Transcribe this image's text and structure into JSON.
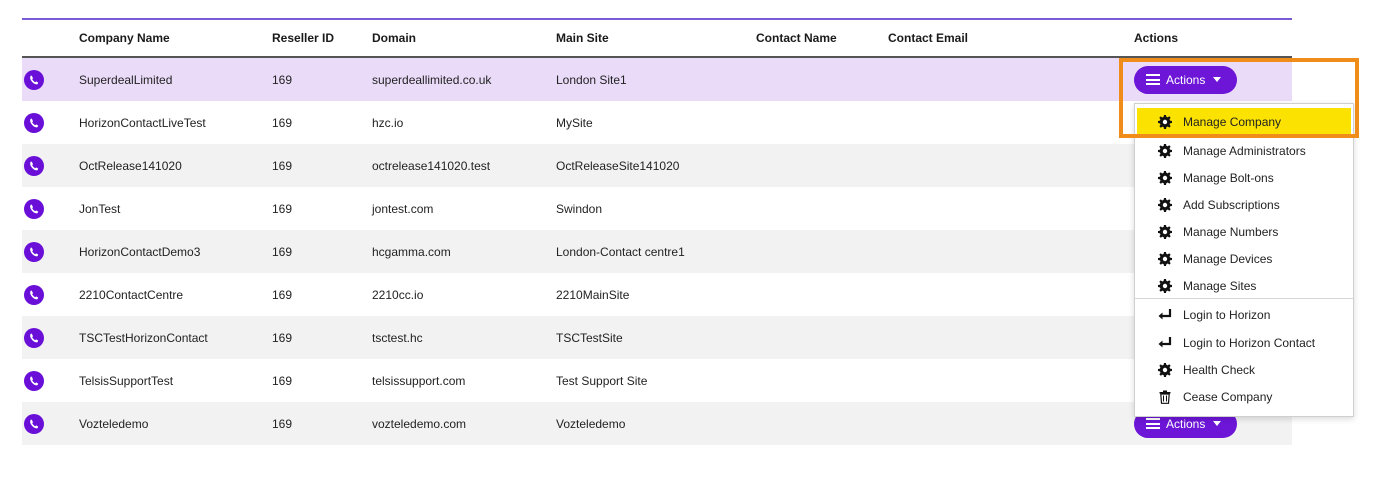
{
  "table": {
    "headers": {
      "company_name": "Company Name",
      "reseller_id": "Reseller ID",
      "domain": "Domain",
      "main_site": "Main Site",
      "contact_name": "Contact Name",
      "contact_email": "Contact Email",
      "actions": "Actions"
    },
    "rows": [
      {
        "company": "SuperdealLimited",
        "reseller": "169",
        "domain": "superdeallimited.co.uk",
        "site": "London Site1",
        "contact_name": "",
        "contact_email": ""
      },
      {
        "company": "HorizonContactLiveTest",
        "reseller": "169",
        "domain": "hzc.io",
        "site": "MySite",
        "contact_name": "",
        "contact_email": ""
      },
      {
        "company": "OctRelease141020",
        "reseller": "169",
        "domain": "octrelease141020.test",
        "site": "OctReleaseSite141020",
        "contact_name": "",
        "contact_email": ""
      },
      {
        "company": "JonTest",
        "reseller": "169",
        "domain": "jontest.com",
        "site": "Swindon",
        "contact_name": "",
        "contact_email": ""
      },
      {
        "company": "HorizonContactDemo3",
        "reseller": "169",
        "domain": "hcgamma.com",
        "site": "London-Contact centre1",
        "contact_name": "",
        "contact_email": ""
      },
      {
        "company": "2210ContactCentre",
        "reseller": "169",
        "domain": "2210cc.io",
        "site": "2210MainSite",
        "contact_name": "",
        "contact_email": ""
      },
      {
        "company": "TSCTestHorizonContact",
        "reseller": "169",
        "domain": "tsctest.hc",
        "site": "TSCTestSite",
        "contact_name": "",
        "contact_email": ""
      },
      {
        "company": "TelsisSupportTest",
        "reseller": "169",
        "domain": "telsissupport.com",
        "site": "Test Support Site",
        "contact_name": "",
        "contact_email": ""
      },
      {
        "company": "Vozteledemo",
        "reseller": "169",
        "domain": "vozteledemo.com",
        "site": "Vozteledemo",
        "contact_name": "",
        "contact_email": ""
      }
    ],
    "actions_label": "Actions"
  },
  "dropdown": {
    "items": [
      {
        "label": "Manage Company",
        "icon": "gear-icon"
      },
      {
        "label": "Manage Administrators",
        "icon": "gear-icon"
      },
      {
        "label": "Manage Bolt-ons",
        "icon": "gear-icon"
      },
      {
        "label": "Add Subscriptions",
        "icon": "gear-icon"
      },
      {
        "label": "Manage Numbers",
        "icon": "gear-icon"
      },
      {
        "label": "Manage Devices",
        "icon": "gear-icon"
      },
      {
        "label": "Manage Sites",
        "icon": "gear-icon"
      },
      {
        "label": "Login to Horizon",
        "icon": "login-arrow-icon"
      },
      {
        "label": "Login to Horizon Contact",
        "icon": "login-arrow-icon"
      },
      {
        "label": "Health Check",
        "icon": "gear-icon"
      },
      {
        "label": "Cease Company",
        "icon": "trash-icon"
      }
    ]
  },
  "colors": {
    "accent": "#6d16d8",
    "highlight_row": "#eadcf9",
    "active_item": "#fbe200",
    "annotation": "#f08c1a"
  }
}
